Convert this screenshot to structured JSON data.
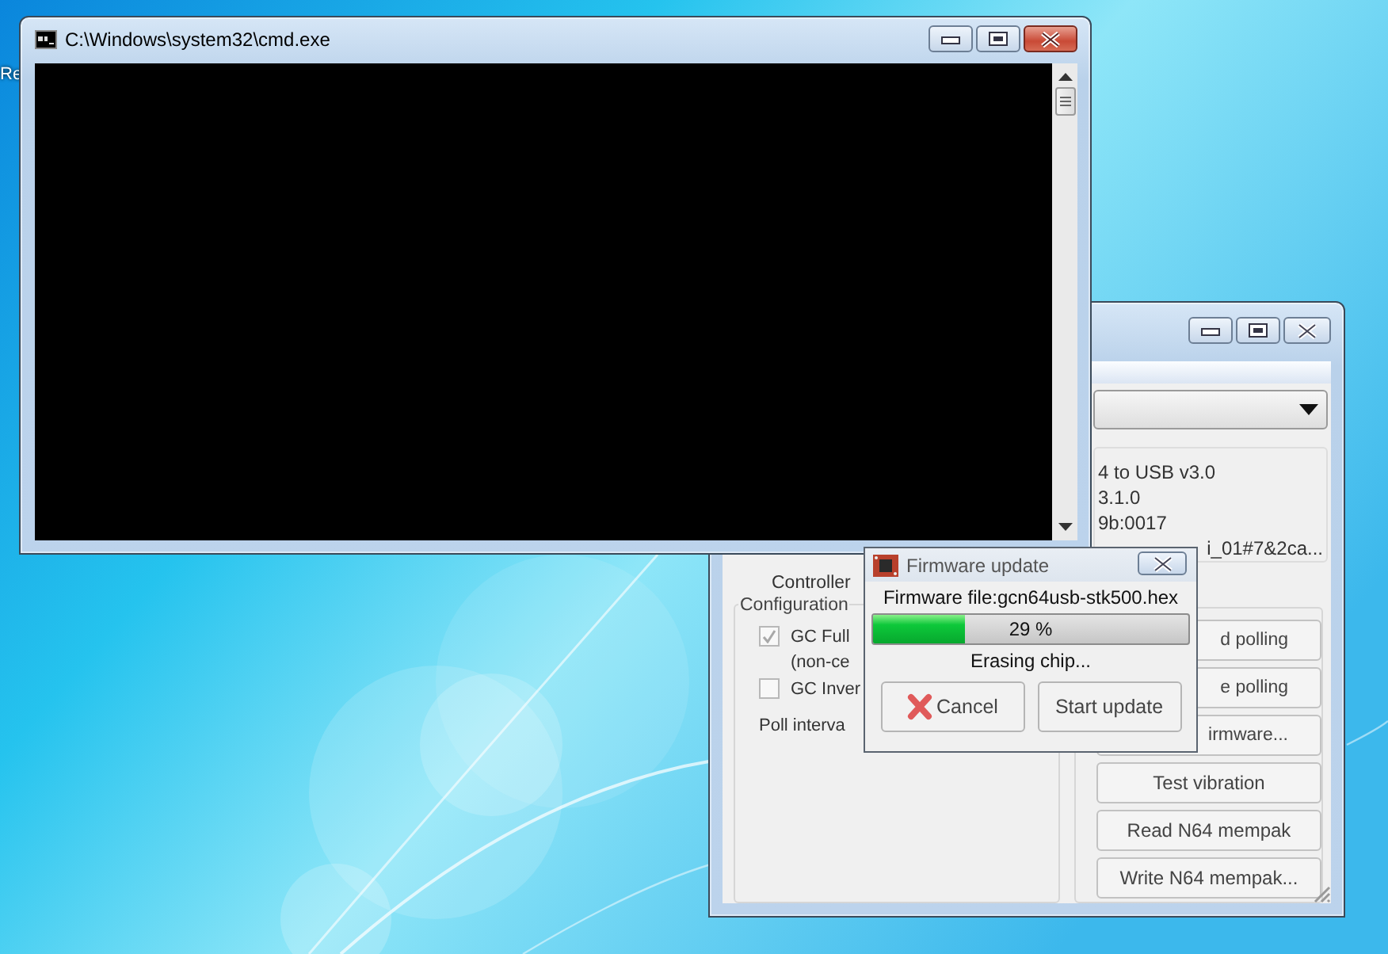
{
  "desktop": {
    "icon_label": "Re"
  },
  "console_window": {
    "title": "C:\\Windows\\system32\\cmd.exe"
  },
  "main_window": {
    "device_info": [
      "4 to USB v3.0",
      "3.1.0",
      "9b:0017",
      "i_01#7&2ca..."
    ],
    "controller_label": "Controller",
    "configuration": {
      "title": "Configuration",
      "options": [
        {
          "label": "GC Full",
          "label_2": "(non-ce",
          "checked": true
        },
        {
          "label": "GC Inver",
          "checked": false
        }
      ],
      "poll_label": "Poll interva"
    },
    "buttons": [
      "d polling",
      "e polling",
      "irmware...",
      "Test vibration",
      "Read N64 mempak",
      "Write N64 mempak..."
    ]
  },
  "firmware_dialog": {
    "title": "Firmware update",
    "file_label": "Firmware file:gcn64usb-stk500.hex",
    "progress": {
      "level": 0.29,
      "reading": "29 %"
    },
    "status": "Erasing chip...",
    "buttons": [
      {
        "kind": "cancel",
        "label": "Cancel"
      },
      {
        "kind": "plain",
        "label": "Start update"
      }
    ]
  }
}
